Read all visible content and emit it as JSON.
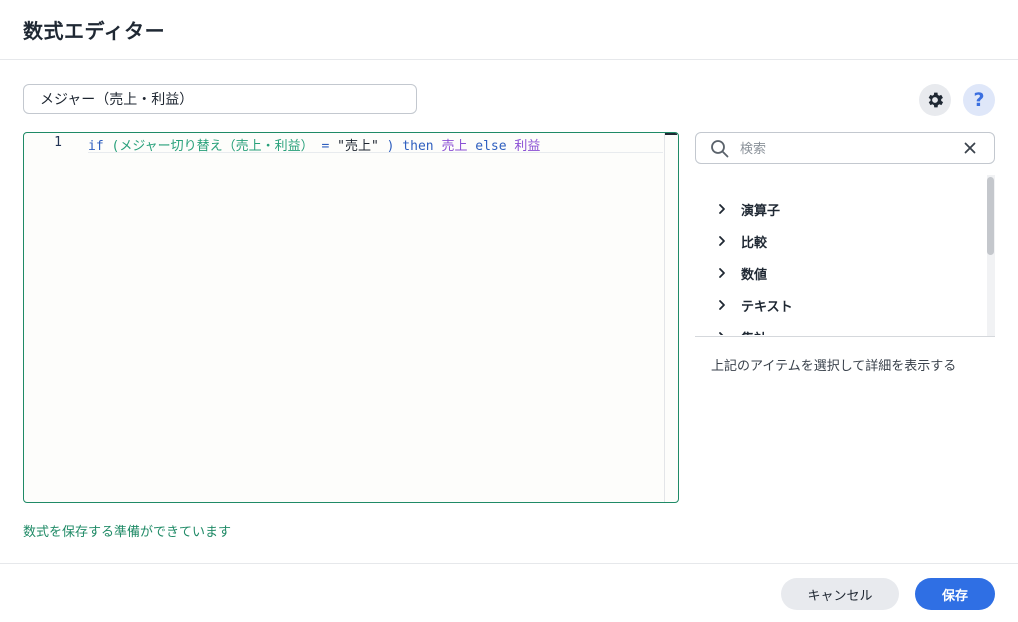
{
  "dialog": {
    "title": "数式エディター"
  },
  "formula_name": {
    "value": "メジャー（売上・利益）"
  },
  "toolbar": {
    "settings_icon": "gear-icon",
    "help_label": "?"
  },
  "editor": {
    "line_number": "1",
    "tokens": {
      "kw_if": "if",
      "open_paren": "(",
      "field": "メジャー切り替え（売上・利益）",
      "op_eq": "=",
      "string": "\"売上\"",
      "close_paren": ")",
      "kw_then": "then",
      "measure_sales": "売上",
      "kw_else": "else",
      "measure_profit": "利益"
    }
  },
  "status": {
    "message": "数式を保存する準備ができています"
  },
  "search": {
    "placeholder": "検索"
  },
  "categories": [
    {
      "label": "演算子"
    },
    {
      "label": "比較"
    },
    {
      "label": "数値"
    },
    {
      "label": "テキスト"
    },
    {
      "label": "集計"
    }
  ],
  "detail": {
    "hint": "上記のアイテムを選択して詳細を表示する"
  },
  "buttons": {
    "cancel": "キャンセル",
    "save": "保存"
  },
  "colors": {
    "accent": "#2f6fe4",
    "success": "#1f8a66",
    "keyword": "#2f5fbf",
    "field": "#27a07a",
    "measure": "#8a4fd4"
  }
}
